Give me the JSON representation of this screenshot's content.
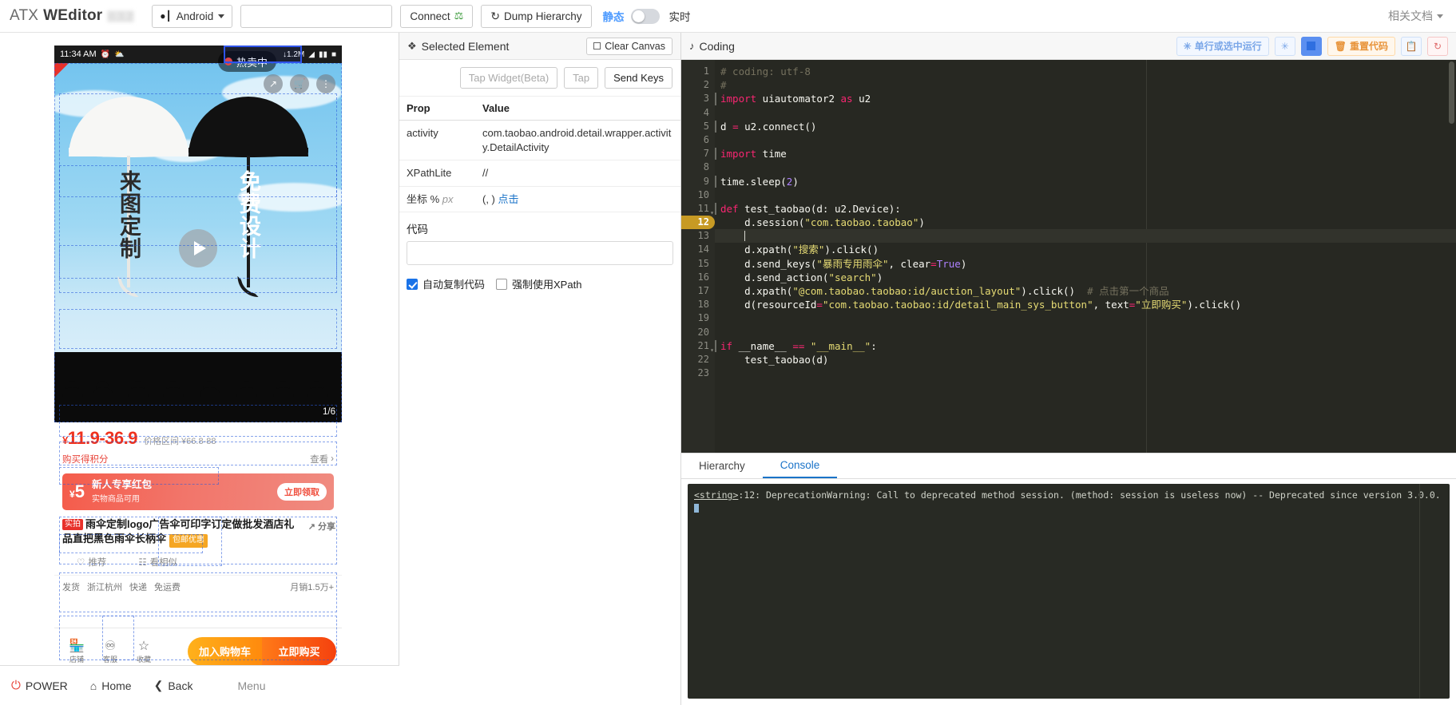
{
  "header": {
    "brand_atx": "ATX",
    "brand_weditor": "WEditor",
    "brand_version": "0.3.2",
    "platform": "Android",
    "serial_value": "",
    "serial_placeholder": "",
    "connect_label": "Connect",
    "dump_label": "Dump Hierarchy",
    "mode_static": "静态",
    "mode_live": "实时",
    "docs_label": "相关文档"
  },
  "device": {
    "statusbar": {
      "time": "11:34 AM",
      "net_speed": "↓1.2M"
    },
    "live_badge": "热卖中",
    "banner": {
      "umbrella_left_text": "来图定制",
      "umbrella_right_text": "免费设计",
      "page_indicator": "1/6"
    },
    "price": {
      "amount": "11.9-36.9",
      "currency": "¥",
      "sub": "价格区间 ¥66.8-88",
      "points_label": "购买得积分",
      "points_more": "查看"
    },
    "coupon": {
      "currency": "¥",
      "amount": "5",
      "title": "新人专享红包",
      "subtitle": "实物商品可用",
      "button": "立即领取"
    },
    "title": {
      "tag": "实拍",
      "text": "雨伞定制logo广告伞可印字订定做批发酒店礼品直把黑色雨伞长柄伞",
      "badge": "包邮优惠",
      "share": "分享"
    },
    "reco": {
      "item1": "推荐",
      "item2": "看相似"
    },
    "ship": {
      "from_label": "发货",
      "location": "浙江杭州",
      "speed_label": "快递",
      "fee": "免运费",
      "sales": "月销1.5万+"
    },
    "bottombar": {
      "item1": "店铺",
      "item2": "客服",
      "item3": "收藏",
      "cart": "加入购物车",
      "buy": "立即购买"
    },
    "footer": {
      "power": "POWER",
      "home": "Home",
      "back": "Back",
      "menu": "Menu"
    }
  },
  "selected_element": {
    "panel_title": "Selected Element",
    "clear_canvas": "Clear Canvas",
    "buttons": {
      "tap_widget": "Tap Widget(Beta)",
      "tap": "Tap",
      "send_keys": "Send Keys"
    },
    "table": {
      "headers": [
        "Prop",
        "Value"
      ],
      "rows": [
        {
          "prop": "activity",
          "value": "com.taobao.android.detail.wrapper.activity.DetailActivity"
        },
        {
          "prop": "XPathLite",
          "value": "//"
        },
        {
          "prop": "坐标 % px",
          "value": "(, )",
          "link": "点击"
        }
      ]
    },
    "code_label": "代码",
    "code_value": "",
    "checkbox_auto_copy": "自动复制代码",
    "checkbox_force_xpath": "强制使用XPath"
  },
  "coding": {
    "panel_title": "Coding",
    "tools": {
      "run_selection": "单行或选中运行",
      "reset_code": "重置代码"
    },
    "active_line": 12,
    "lines": [
      {
        "n": 1,
        "bar": false,
        "segs": [
          {
            "t": "# coding: utf-8",
            "c": "k-com"
          }
        ]
      },
      {
        "n": 2,
        "bar": false,
        "segs": [
          {
            "t": "#",
            "c": "k-com"
          }
        ]
      },
      {
        "n": 3,
        "bar": true,
        "segs": [
          {
            "t": "import",
            "c": "k-kw"
          },
          {
            "t": " uiautomator2 ",
            "c": ""
          },
          {
            "t": "as",
            "c": "k-kw"
          },
          {
            "t": " u2",
            "c": ""
          }
        ]
      },
      {
        "n": 4,
        "bar": false,
        "segs": []
      },
      {
        "n": 5,
        "bar": true,
        "segs": [
          {
            "t": "d ",
            "c": ""
          },
          {
            "t": "=",
            "c": "k-kw"
          },
          {
            "t": " u2.connect()",
            "c": ""
          }
        ]
      },
      {
        "n": 6,
        "bar": false,
        "segs": []
      },
      {
        "n": 7,
        "bar": true,
        "segs": [
          {
            "t": "import",
            "c": "k-kw"
          },
          {
            "t": " time",
            "c": ""
          }
        ]
      },
      {
        "n": 8,
        "bar": false,
        "segs": []
      },
      {
        "n": 9,
        "bar": true,
        "segs": [
          {
            "t": "time.sleep(",
            "c": ""
          },
          {
            "t": "2",
            "c": "k-num"
          },
          {
            "t": ")",
            "c": ""
          }
        ]
      },
      {
        "n": 10,
        "bar": false,
        "segs": []
      },
      {
        "n": 11,
        "bar": true,
        "fold": true,
        "segs": [
          {
            "t": "def",
            "c": "k-kw"
          },
          {
            "t": " test_taobao(d: u2.Device):",
            "c": ""
          }
        ]
      },
      {
        "n": 12,
        "bar": false,
        "active": true,
        "segs": [
          {
            "t": "    d.session(",
            "c": ""
          },
          {
            "t": "\"com.taobao.taobao\"",
            "c": "k-str"
          },
          {
            "t": ")",
            "c": ""
          }
        ]
      },
      {
        "n": 13,
        "bar": false,
        "hl": true,
        "caret": true,
        "segs": [
          {
            "t": "    ",
            "c": ""
          }
        ]
      },
      {
        "n": 14,
        "bar": false,
        "segs": [
          {
            "t": "    d.xpath(",
            "c": ""
          },
          {
            "t": "\"搜索\"",
            "c": "k-str"
          },
          {
            "t": ").click()",
            "c": ""
          }
        ]
      },
      {
        "n": 15,
        "bar": false,
        "segs": [
          {
            "t": "    d.send_keys(",
            "c": ""
          },
          {
            "t": "\"暴雨专用雨伞\"",
            "c": "k-str"
          },
          {
            "t": ", clear",
            "c": ""
          },
          {
            "t": "=",
            "c": "k-kw"
          },
          {
            "t": "True",
            "c": "k-num"
          },
          {
            "t": ")",
            "c": ""
          }
        ]
      },
      {
        "n": 16,
        "bar": false,
        "segs": [
          {
            "t": "    d.send_action(",
            "c": ""
          },
          {
            "t": "\"search\"",
            "c": "k-str"
          },
          {
            "t": ")",
            "c": ""
          }
        ]
      },
      {
        "n": 17,
        "bar": false,
        "segs": [
          {
            "t": "    d.xpath(",
            "c": ""
          },
          {
            "t": "\"@com.taobao.taobao:id/auction_layout\"",
            "c": "k-str"
          },
          {
            "t": ").click()",
            "c": ""
          },
          {
            "t": "  # 点击第一个商品",
            "c": "k-com"
          }
        ]
      },
      {
        "n": 18,
        "bar": false,
        "segs": [
          {
            "t": "    d(resourceId",
            "c": ""
          },
          {
            "t": "=",
            "c": "k-kw"
          },
          {
            "t": "\"com.taobao.taobao:id/detail_main_sys_button\"",
            "c": "k-str"
          },
          {
            "t": ", text",
            "c": ""
          },
          {
            "t": "=",
            "c": "k-kw"
          },
          {
            "t": "\"立即购买\"",
            "c": "k-str"
          },
          {
            "t": ").click()",
            "c": ""
          }
        ]
      },
      {
        "n": 19,
        "bar": false,
        "segs": []
      },
      {
        "n": 20,
        "bar": false,
        "segs": []
      },
      {
        "n": 21,
        "bar": true,
        "fold": true,
        "segs": [
          {
            "t": "if",
            "c": "k-kw"
          },
          {
            "t": " __name__ ",
            "c": ""
          },
          {
            "t": "==",
            "c": "k-kw"
          },
          {
            "t": " ",
            "c": ""
          },
          {
            "t": "\"__main__\"",
            "c": "k-str"
          },
          {
            "t": ":",
            "c": ""
          }
        ]
      },
      {
        "n": 22,
        "bar": false,
        "segs": [
          {
            "t": "    test_taobao(d)",
            "c": ""
          }
        ]
      },
      {
        "n": 23,
        "bar": false,
        "segs": []
      }
    ]
  },
  "bottom": {
    "tabs": [
      {
        "label": "Hierarchy",
        "active": false
      },
      {
        "label": "Console",
        "active": true
      }
    ],
    "console_text": "<string>:12: DeprecationWarning: Call to deprecated method session. (method: session is useless now) -- Deprecated since version 3.0.0."
  }
}
